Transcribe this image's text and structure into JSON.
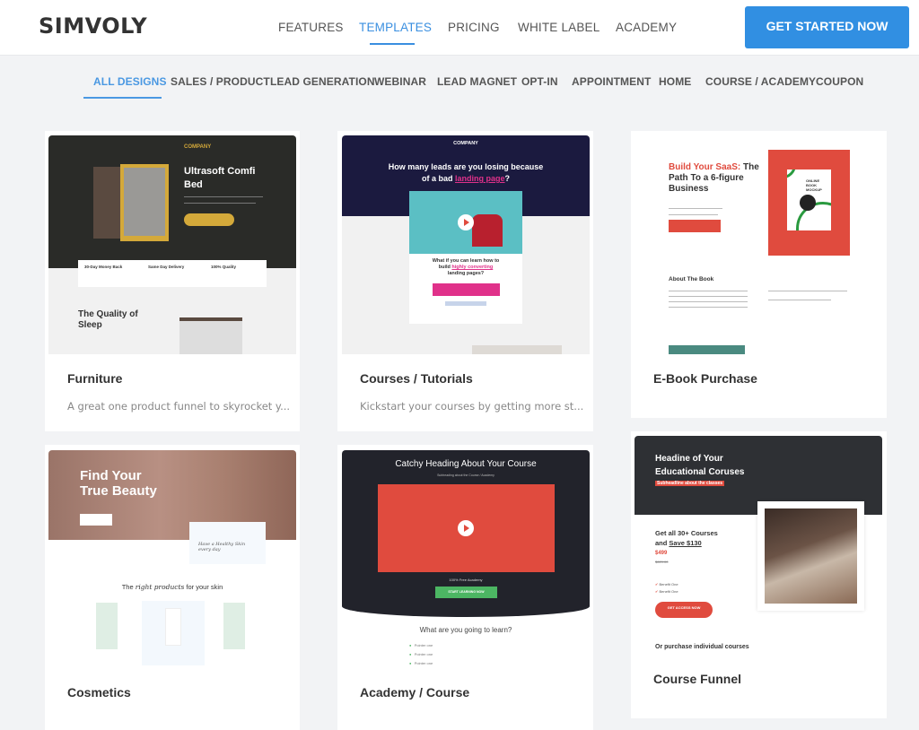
{
  "header": {
    "logo": "SIMVOLY",
    "nav": [
      "FEATURES",
      "TEMPLATES",
      "PRICING",
      "WHITE LABEL",
      "ACADEMY"
    ],
    "active_nav": "TEMPLATES",
    "cta": "GET STARTED NOW"
  },
  "categories": {
    "items": [
      "ALL DESIGNS",
      "SALES / PRODUCT",
      "LEAD GENERATION",
      "WEBINAR",
      "LEAD MAGNET",
      "OPT-IN",
      "APPOINTMENT",
      "HOME",
      "COURSE / ACADEMY",
      "COUPON"
    ],
    "active": "ALL DESIGNS"
  },
  "templates": [
    {
      "title": "Furniture",
      "description": "A great one product funnel to skyrocket y...",
      "preview": {
        "brand": "COMPANY",
        "headline_1": "Ultrasoft Comfi",
        "headline_2": "Bed",
        "features": [
          "30-Day Money Back",
          "Same Day Delivery",
          "100% Quality"
        ],
        "section_1": "The Quality of",
        "section_2": "Sleep"
      }
    },
    {
      "title": "Courses / Tutorials",
      "description": "Kickstart your courses by getting more st...",
      "preview": {
        "brand": "COMPANY",
        "headline_1": "How many leads are you losing because",
        "headline_2a": "of a bad ",
        "headline_2b": "landing page",
        "headline_2c": "?",
        "sub_1": "What if you can learn how to",
        "sub_2a": "build ",
        "sub_2b": "highly converting",
        "sub_3": "landing pages?"
      }
    },
    {
      "title": "E-Book Purchase",
      "description": "",
      "preview": {
        "headline_accent": "Build Your SaaS:",
        "headline_rest_1": " The",
        "headline_2": "Path To a 6-figure",
        "headline_3": "Business",
        "book_1": "ONLINE",
        "book_2": "BOOK",
        "book_3": "MOCKUP",
        "section": "About The Book"
      }
    },
    {
      "title": "Cosmetics",
      "description": "",
      "preview": {
        "headline_1": "Find Your",
        "headline_2": "True Beauty",
        "card_1": "Have a Healthy Skin",
        "card_2": "every day",
        "section_a": "The ",
        "section_b": "right products",
        "section_c": " for your skin"
      }
    },
    {
      "title": "Academy / Course",
      "description": "",
      "preview": {
        "headline": "Catchy Heading About Your Course",
        "sub": "Subheading about the Course / Academy",
        "free": "100% Free Academy",
        "button": "START LEARNING NOW",
        "section": "What are you going to learn?",
        "pointers": [
          "Pointer one",
          "Pointer one",
          "Pointer one"
        ]
      }
    },
    {
      "title": "Course Funnel",
      "description": "",
      "preview": {
        "headline_1": "Headine of Your",
        "headline_2": "Educational Coruses",
        "sub": "Subheadline about the classes",
        "offer_1": "Get all 30+ Courses",
        "offer_2a": "and ",
        "offer_2b": "Save $130",
        "price": "$499",
        "old_price": "$629.00",
        "benefits": [
          "Benefit One",
          "Benefit One"
        ],
        "button": "GET ACCESS NOW",
        "footer": "Or purchase individual courses"
      }
    }
  ],
  "colors": {
    "accent": "#318fe2",
    "active_category": "#4a98e2",
    "background": "#f2f3f5"
  }
}
